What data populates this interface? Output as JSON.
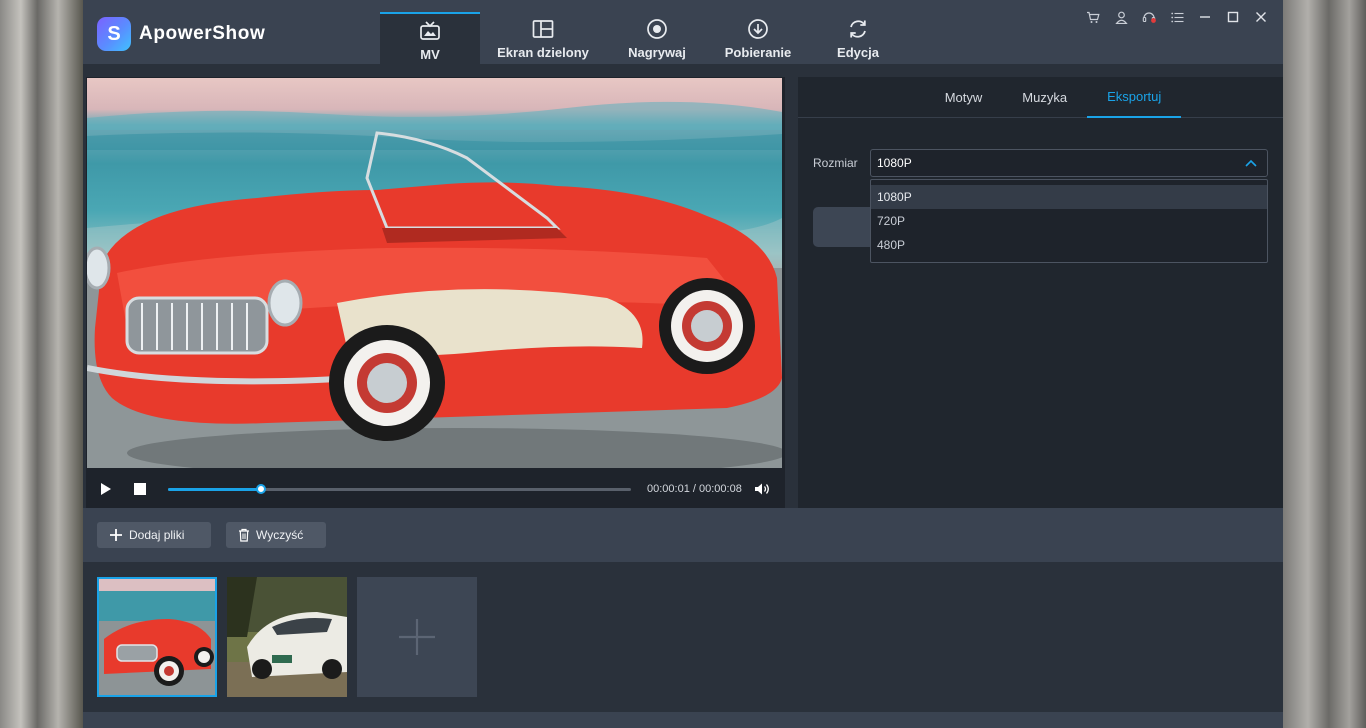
{
  "app": {
    "name": "ApowerShow",
    "logo_letter": "S"
  },
  "nav": {
    "items": [
      {
        "label": "MV",
        "icon": "tv-icon",
        "active": true
      },
      {
        "label": "Ekran dzielony",
        "icon": "split-screen-icon",
        "active": false
      },
      {
        "label": "Nagrywaj",
        "icon": "record-icon",
        "active": false
      },
      {
        "label": "Pobieranie",
        "icon": "download-icon",
        "active": false
      },
      {
        "label": "Edycja",
        "icon": "refresh-icon",
        "active": false
      }
    ]
  },
  "window_controls": [
    "cart-icon",
    "user-icon",
    "support-icon",
    "menu-icon",
    "minimize-icon",
    "maximize-icon",
    "close-icon"
  ],
  "player": {
    "time": "00:00:01 / 00:00:08",
    "progress": 0.2
  },
  "panel": {
    "tabs": [
      {
        "label": "Motyw",
        "active": false
      },
      {
        "label": "Muzyka",
        "active": false
      },
      {
        "label": "Eksportuj",
        "active": true
      }
    ],
    "size_label": "Rozmiar",
    "size_value": "1080P",
    "size_options": [
      "1080P",
      "720P",
      "480P"
    ]
  },
  "toolbar": {
    "add_files": "Dodaj pliki",
    "clear": "Wyczyść"
  },
  "colors": {
    "accent": "#1aa3e8",
    "header": "#3a4351",
    "background": "#2a313b"
  }
}
